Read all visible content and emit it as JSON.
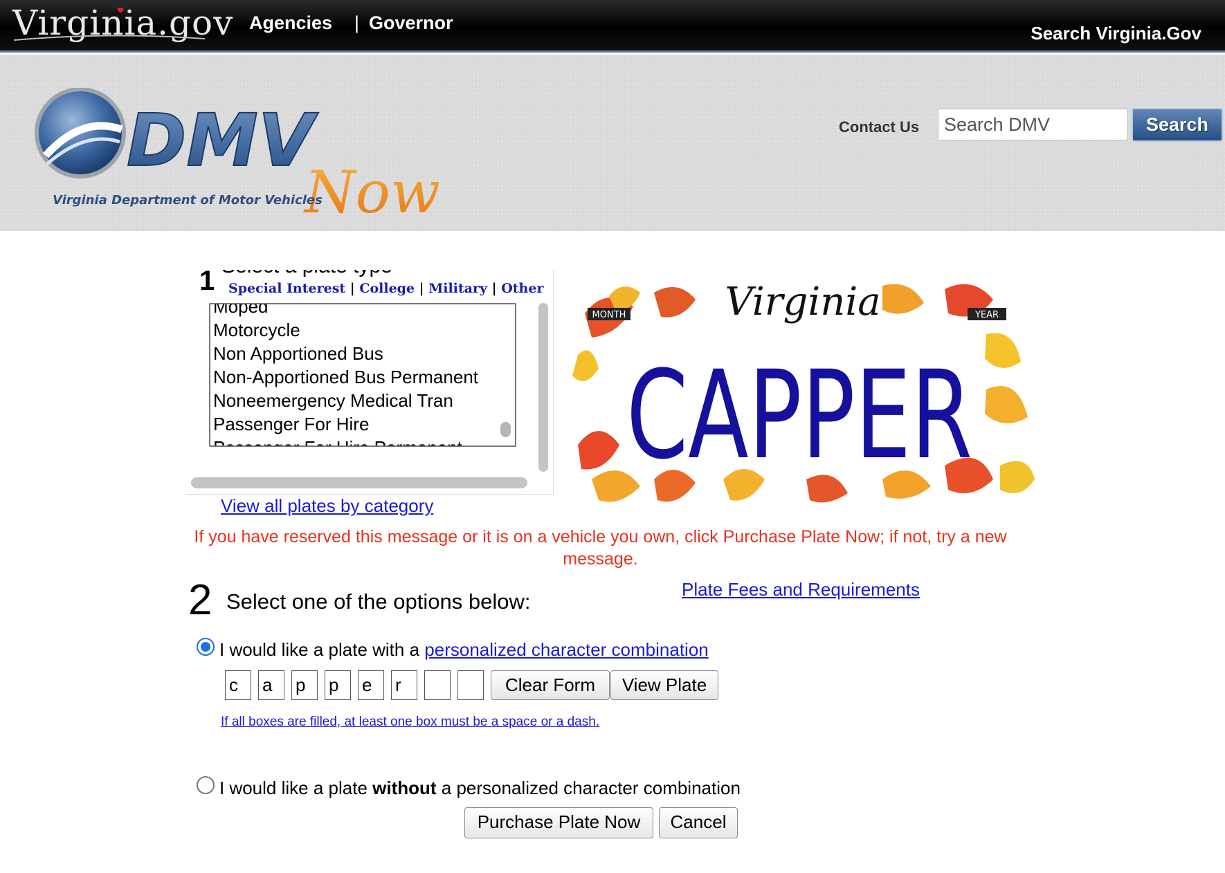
{
  "topbar": {
    "logo_text": "Virginia.gov",
    "nav": {
      "agencies": "Agencies",
      "separator": "|",
      "governor": "Governor"
    },
    "search_link": "Search Virginia.Gov"
  },
  "header": {
    "logo_main": "DMV",
    "logo_sub": "Now",
    "logo_caption": "Virginia Department of Motor Vehicles",
    "contact_us": "Contact Us",
    "search_placeholder": "Search DMV",
    "search_button": "Search"
  },
  "step1": {
    "number": "1",
    "heading": "Select a plate type",
    "categories": {
      "special_interest": "Special Interest",
      "college": "College",
      "military": "Military",
      "other": "Other",
      "separator": "|"
    },
    "plate_types": [
      "Moped",
      "Motorcycle",
      "Non Apportioned Bus",
      "Non-Apportioned Bus Permanent",
      "Noneemergency Medical Tran",
      "Passenger For Hire",
      "Passenger For Hire Permanent"
    ],
    "view_all_link": "View all plates by category"
  },
  "plate_preview": {
    "state": "Virginia",
    "text": "CAPPER",
    "month_label": "MONTH",
    "year_label": "YEAR",
    "text_color": "#16119c"
  },
  "reserved_message": "If you have reserved this message or it is on a vehicle you own, click Purchase Plate Now; if not, try a new message.",
  "step2": {
    "number": "2",
    "heading": "Select one of the options below:",
    "fees_link": "Plate Fees and Requirements",
    "option_personalized": {
      "text_before": "I would like a plate with a ",
      "link": "personalized character combination",
      "selected": true
    },
    "characters": [
      "c",
      "a",
      "p",
      "p",
      "e",
      "r",
      "",
      ""
    ],
    "clear_form": "Clear Form",
    "view_plate": "View Plate",
    "hint": "If all boxes are filled, at least one box must be a space or a dash.",
    "option_plain": {
      "text_before": "I would like a plate ",
      "bold": "without",
      "text_after": " a personalized character combination",
      "selected": false
    }
  },
  "actions": {
    "purchase": "Purchase Plate Now",
    "cancel": "Cancel"
  },
  "colors": {
    "link": "#1a1ad8",
    "warning": "#e8321e",
    "search_button": "#2f5a90"
  }
}
